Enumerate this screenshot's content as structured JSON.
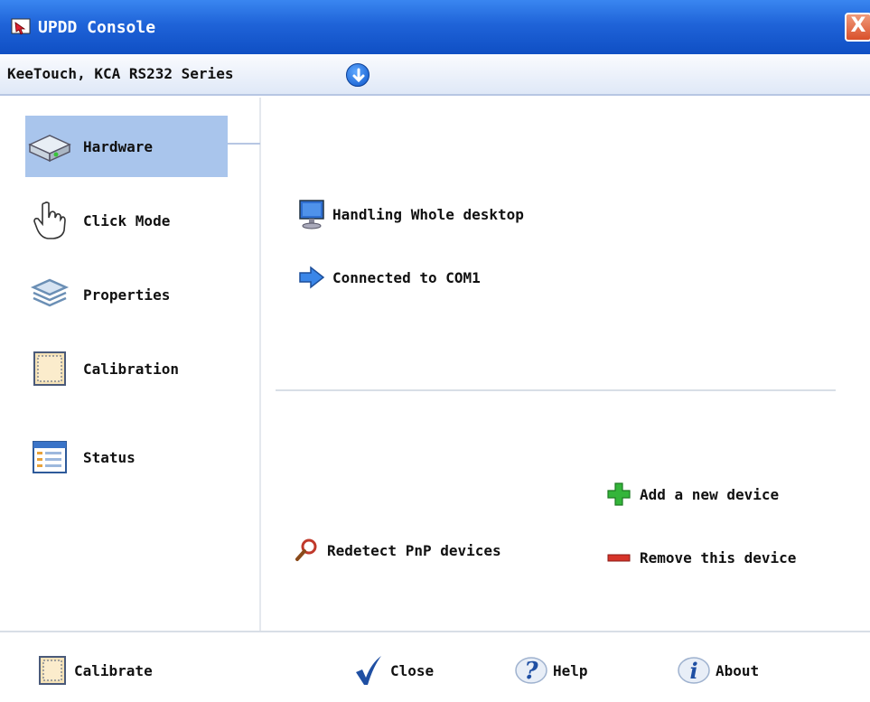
{
  "window": {
    "title": "UPDD Console",
    "close_glyph": "X",
    "accent": "#1f63d8"
  },
  "device_bar": {
    "device_name": "KeeTouch, KCA RS232 Series",
    "dropdown_icon": "circle-arrow-down-icon"
  },
  "sidebar": {
    "items": [
      {
        "label": "Hardware",
        "icon": "hard-drive-icon",
        "selected": true
      },
      {
        "label": "Click Mode",
        "icon": "hand-pointer-icon",
        "selected": false
      },
      {
        "label": "Properties",
        "icon": "layers-icon",
        "selected": false
      },
      {
        "label": "Calibration",
        "icon": "calibration-icon",
        "selected": false
      },
      {
        "label": "Status",
        "icon": "status-window-icon",
        "selected": false
      }
    ]
  },
  "main": {
    "desktop_status": "Handling Whole desktop",
    "connection_status": "Connected to COM1",
    "redetect_label": "Redetect PnP devices",
    "add_device_label": "Add a new device",
    "remove_device_label": "Remove this device"
  },
  "bottom": {
    "calibrate_label": "Calibrate",
    "close_label": "Close",
    "help_label": "Help",
    "about_label": "About"
  }
}
